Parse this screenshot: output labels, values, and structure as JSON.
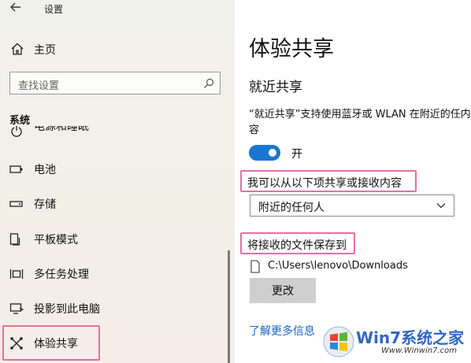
{
  "window": {
    "title": "设置"
  },
  "sidebar": {
    "home_label": "主页",
    "search_placeholder": "查找设置",
    "section_label": "系统",
    "items": [
      {
        "label": "电源和睡眠",
        "icon": "power-icon"
      },
      {
        "label": "电池",
        "icon": "battery-icon"
      },
      {
        "label": "存储",
        "icon": "storage-icon"
      },
      {
        "label": "平板模式",
        "icon": "tablet-mode-icon"
      },
      {
        "label": "多任务处理",
        "icon": "multitasking-icon"
      },
      {
        "label": "投影到此电脑",
        "icon": "project-icon"
      },
      {
        "label": "体验共享",
        "icon": "shared-experiences-icon",
        "selected": true
      }
    ]
  },
  "main": {
    "title": "体验共享",
    "nearby": {
      "heading": "就近共享",
      "description": "“就近共享”支持使用蓝牙或 WLAN 在附近的任内容",
      "toggle_state": "开",
      "toggle_on": true
    },
    "share_from_label": "我可以从以下项共享或接收内容",
    "share_from_value": "附近的任何人",
    "save_to_label": "将接收的文件保存到",
    "save_path": "C:\\Users\\lenovo\\Downloads",
    "change_button": "更改",
    "learn_more": "了解更多信息"
  },
  "watermark": {
    "brand": "Win7系统之家",
    "url": "Www.Winwin7.com"
  },
  "colors": {
    "accent": "#1976d2",
    "highlight": "#e56fa6",
    "link": "#1a63c6"
  }
}
